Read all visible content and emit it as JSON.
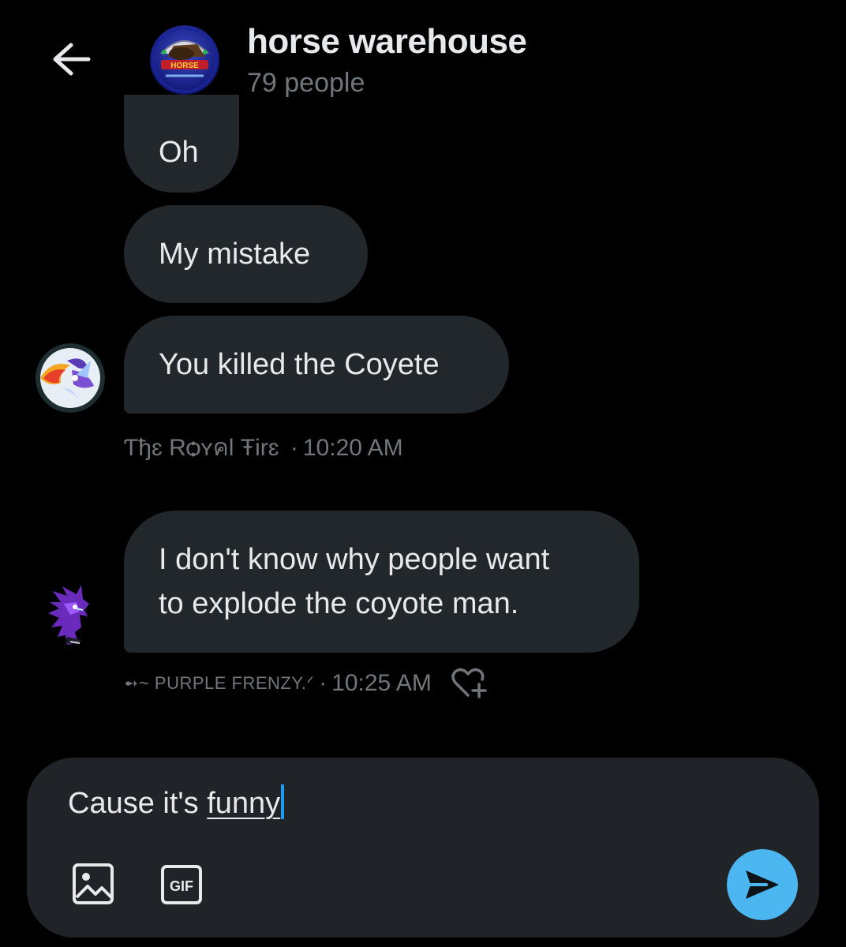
{
  "header": {
    "back_icon": "arrow-left-icon",
    "group_name": "horse warehouse",
    "member_count": "79 people",
    "avatar_logo_text": "HORSE"
  },
  "messages": [
    {
      "text": "Oh"
    },
    {
      "text": "My mistake"
    },
    {
      "text": "You killed the Coyete"
    },
    {
      "text_line1": "I don't know why people want",
      "text_line2": "to explode the coyote man."
    }
  ],
  "meta": {
    "royal": {
      "sender": "Ƭђɛ Rѻʏคl Ŧirɛ",
      "separator": "·",
      "time": "10:20 AM"
    },
    "purple": {
      "sender": "➻~ PURPLE FRENZY.ᐟ",
      "separator": "·",
      "time": "10:25 AM",
      "react_icon": "heart-plus-icon"
    }
  },
  "composer": {
    "text_plain": "Cause it's ",
    "text_underlined": "funny",
    "media_icon": "image-icon",
    "gif_label": "GIF",
    "send_icon": "send-icon"
  },
  "colors": {
    "background": "#000000",
    "bubble": "#22272b",
    "text": "#e7e9ea",
    "muted": "#71767b",
    "accent": "#4cb6f0",
    "caret": "#1d9bf0"
  }
}
